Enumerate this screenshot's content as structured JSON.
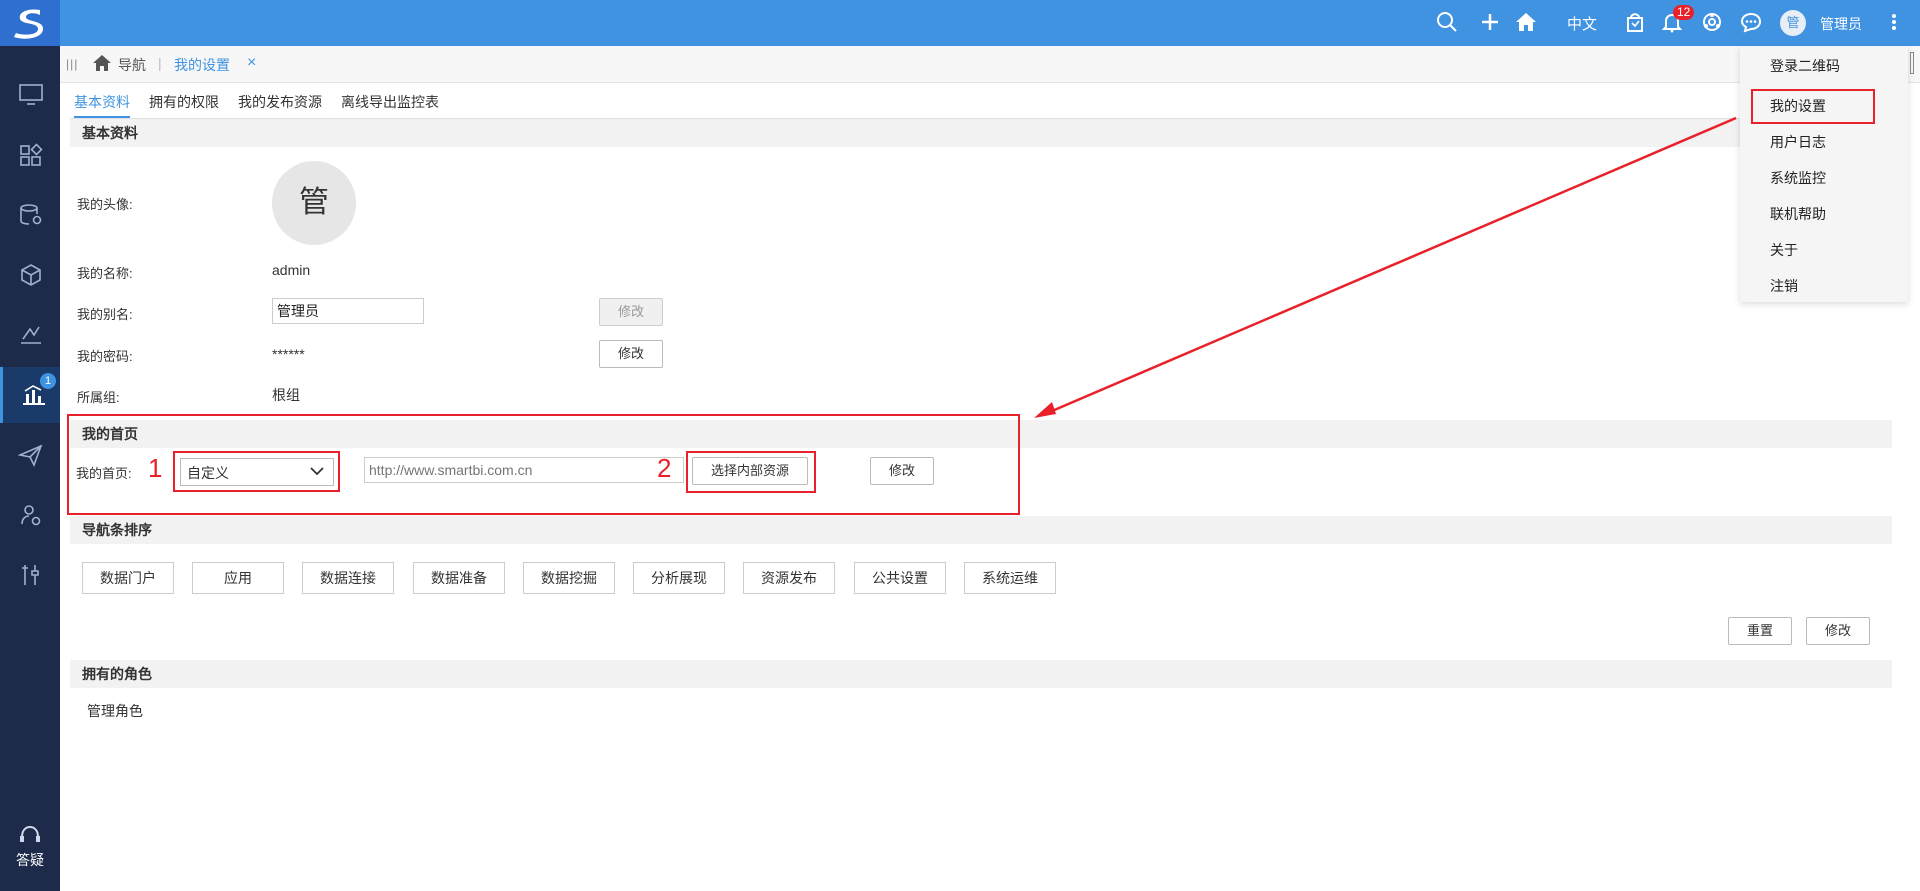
{
  "topbar": {
    "language": "中文",
    "notification_count": "12",
    "avatar_initial": "管",
    "user_name": "管理员"
  },
  "sidebar": {
    "items": [
      {
        "icon": "monitor-icon"
      },
      {
        "icon": "apps-grid-icon"
      },
      {
        "icon": "database-settings-icon"
      },
      {
        "icon": "cube-icon"
      },
      {
        "icon": "pen-chart-icon"
      },
      {
        "icon": "bar-chart-icon",
        "badge": "1",
        "active": true
      },
      {
        "icon": "send-icon"
      },
      {
        "icon": "model-settings-icon"
      },
      {
        "icon": "tools-icon"
      }
    ],
    "help_label": "答疑"
  },
  "tabbar": {
    "nav_label": "导航",
    "active_tab": "我的设置",
    "close": "×"
  },
  "subtabs": [
    "基本资料",
    "拥有的权限",
    "我的发布资源",
    "离线导出监控表"
  ],
  "basic": {
    "section_title": "基本资料",
    "avatar_label": "我的头像:",
    "avatar_char": "管",
    "name_label": "我的名称:",
    "name_value": "admin",
    "alias_label": "我的别名:",
    "alias_value": "管理员",
    "alias_button": "修改",
    "password_label": "我的密码:",
    "password_value": "******",
    "password_button": "修改",
    "group_label": "所属组:",
    "group_value": "根组"
  },
  "homepage": {
    "section_title": "我的首页",
    "label": "我的首页:",
    "select_value": "自定义",
    "url_placeholder": "http://www.smartbi.com.cn",
    "choose_button": "选择内部资源",
    "modify_button": "修改",
    "annotation_1": "1",
    "annotation_2": "2"
  },
  "nav_order": {
    "section_title": "导航条排序",
    "items": [
      "数据门户",
      "应用",
      "数据连接",
      "数据准备",
      "数据挖掘",
      "分析展现",
      "资源发布",
      "公共设置",
      "系统运维"
    ],
    "reset_button": "重置",
    "modify_button": "修改"
  },
  "roles": {
    "section_title": "拥有的角色",
    "role": "管理角色"
  },
  "dropdown": {
    "items": [
      "登录二维码",
      "我的设置",
      "用户日志",
      "系统监控",
      "联机帮助",
      "关于",
      "注销"
    ]
  },
  "colors": {
    "topbar": "#3f93e0",
    "sidebar": "#1e2a4a",
    "accent": "#3f93e0",
    "annotation_red": "#e8212a"
  }
}
